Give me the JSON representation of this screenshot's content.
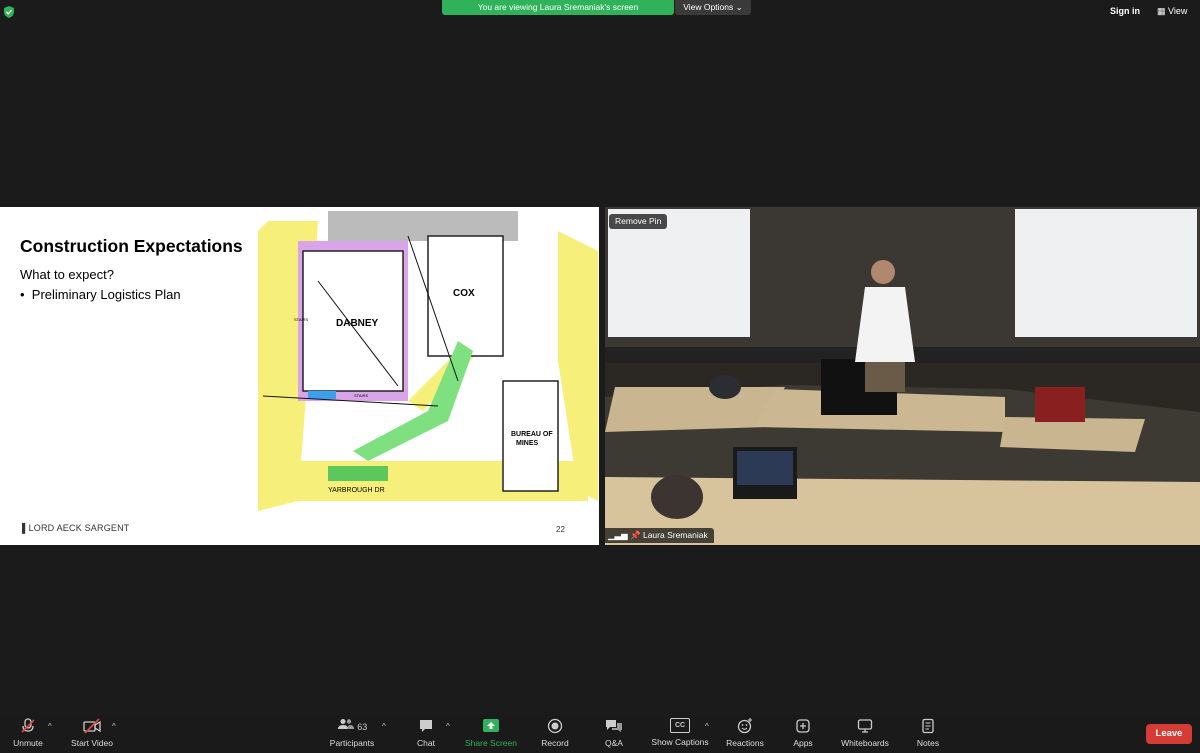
{
  "banner": {
    "viewing_text": "You are viewing Laura Sremaniak's screen",
    "view_options_label": "View Options"
  },
  "topright": {
    "signin_label": "Sign in",
    "view_label": "View"
  },
  "slide": {
    "title": "Construction Expectations",
    "subtitle": "What to expect?",
    "bullet": "Preliminary Logistics Plan",
    "logo_text": "LORD AECK SARGENT",
    "page_number": "22",
    "plan_labels": {
      "dabney": "DABNEY",
      "cox": "COX",
      "bureau": "BUREAU OF",
      "mines": "MINES",
      "street": "YARBROUGH DR",
      "stairs1": "STAIRS",
      "stairs2": "STAIRS"
    }
  },
  "video": {
    "remove_pin_label": "Remove Pin",
    "participant_name": "Laura Sremaniak"
  },
  "toolbar": {
    "unmute": "Unmute",
    "start_video": "Start Video",
    "participants": "Participants",
    "participants_count": "63",
    "chat": "Chat",
    "share_screen": "Share Screen",
    "record": "Record",
    "qa": "Q&A",
    "show_captions": "Show Captions",
    "captions_icon_text": "CC",
    "reactions": "Reactions",
    "apps": "Apps",
    "whiteboards": "Whiteboards",
    "notes": "Notes",
    "leave": "Leave"
  },
  "colors": {
    "share_green": "#2fb25a",
    "leave_red": "#d63b35",
    "toolbar_bg": "#1a1a1a"
  }
}
